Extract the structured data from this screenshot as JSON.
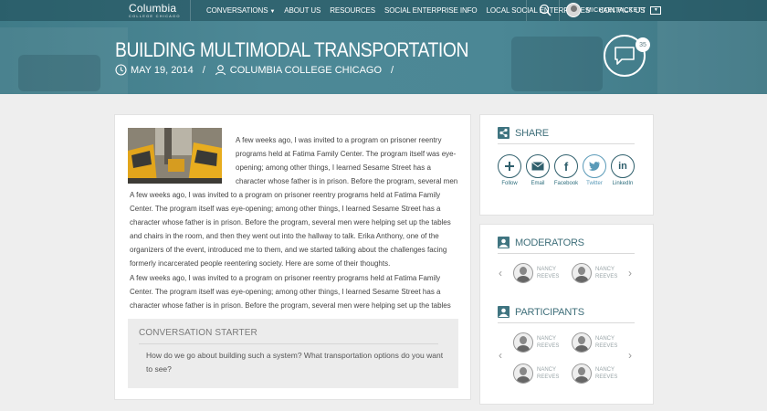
{
  "nav": {
    "logo_name": "Columbia",
    "logo_sub": "COLLEGE CHICAGO",
    "menu": [
      {
        "label": "CONVERSATIONS"
      },
      {
        "label": "ABOUT US"
      },
      {
        "label": "RESOURCES"
      },
      {
        "label": "SOCIAL ENTERPRISE INFO"
      },
      {
        "label": "LOCAL SOCIAL ENTERPRISES"
      },
      {
        "label": "CONTACT US"
      }
    ],
    "username": "MICHAEL PICKETT"
  },
  "hero": {
    "title": "BUILDING MULTIMODAL TRANSPORTATION",
    "date": "MAY 19, 2014",
    "author": "COLUMBIA COLLEGE CHICAGO",
    "slash": "/",
    "comment_count": "35"
  },
  "article": {
    "paragraphs": [
      "A few weeks ago, I was invited to a program on prisoner reentry programs held at Fatima Family Center. The program itself was eye-opening; among other things, I learned Sesame Street has a character whose father is in prison. Before the program, several men",
      "A few weeks ago, I was invited to a program on prisoner reentry programs held at Fatima Family Center. The program itself was eye-opening; among other things, I learned Sesame Street has a character whose father is in prison. Before the program, several men were helping set up the tables and chairs in the room, and then they went out into the hallway to talk. Erika Anthony, one of the organizers of the event, introduced me to them, and we started talking about the challenges facing formerly incarcerated people reentering society. Here are some of their thoughts.",
      " A few weeks ago, I was invited to a program on prisoner reentry programs held at Fatima Family Center. The program itself was eye-opening; among other things, I learned Sesame Street has a character whose father is in prison. Before the program, several men were helping set up the tables"
    ],
    "starter_title": "CONVERSATION STARTER",
    "starter_text": "How do we go about building such a system? What transportation options do you want to see?"
  },
  "share": {
    "title": "SHARE",
    "buttons": [
      {
        "label": "Follow",
        "icon": "plus-icon"
      },
      {
        "label": "Email",
        "icon": "email-icon"
      },
      {
        "label": "Facebook",
        "icon": "facebook-icon"
      },
      {
        "label": "Twitter",
        "icon": "twitter-icon"
      },
      {
        "label": "LinkedIn",
        "icon": "linkedin-icon"
      }
    ]
  },
  "moderators": {
    "title": "MODERATORS",
    "people": [
      {
        "first": "NANCY",
        "last": "REEVES"
      },
      {
        "first": "NANCY",
        "last": "REEVES"
      }
    ]
  },
  "participants": {
    "title": "PARTICIPANTS",
    "people": [
      {
        "first": "NANCY",
        "last": "REEVES"
      },
      {
        "first": "NANCY",
        "last": "REEVES"
      },
      {
        "first": "NANCY",
        "last": "REEVES"
      },
      {
        "first": "NANCY",
        "last": "REEVES"
      }
    ]
  },
  "colors": {
    "hero": "#4b8795",
    "accent": "#3f7480",
    "link": "#2f6f7e"
  }
}
